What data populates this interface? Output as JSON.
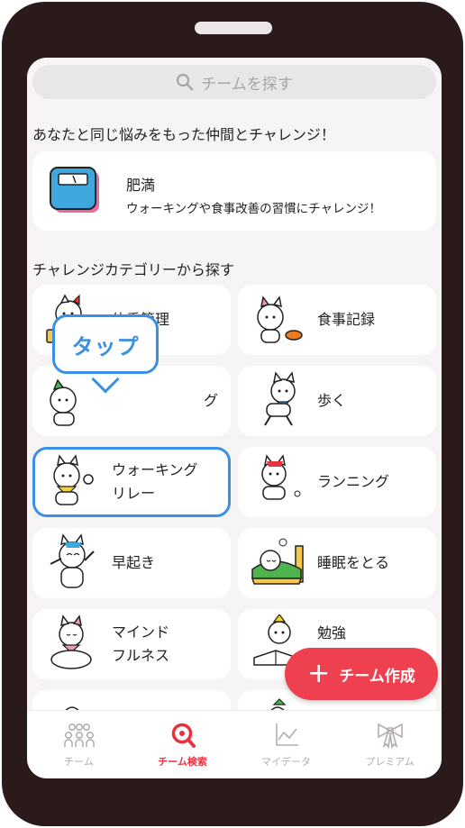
{
  "search": {
    "placeholder": "チームを探す"
  },
  "featured_section": {
    "title": "あなたと同じ悩みをもった仲間とチャレンジ！",
    "card": {
      "title": "肥満",
      "description": "ウォーキングや食事改善の習慣にチャレンジ！",
      "icon": "scale-icon"
    }
  },
  "category_section": {
    "title": "チャレンジカテゴリーから探す",
    "items": [
      {
        "label": "体重管理",
        "icon": "cat-scale-icon"
      },
      {
        "label": "食事記録",
        "icon": "cat-eating-icon"
      },
      {
        "label": "グ",
        "icon": "cat-exercise-icon"
      },
      {
        "label": "歩く",
        "icon": "cat-walking-icon"
      },
      {
        "label1": "ウォーキング",
        "label2": "リレー",
        "icon": "cat-relay-icon"
      },
      {
        "label": "ランニング",
        "icon": "cat-running-icon"
      },
      {
        "label": "早起き",
        "icon": "cat-wakeup-icon"
      },
      {
        "label": "睡眠をとる",
        "icon": "cat-sleep-icon"
      },
      {
        "label1": "マインド",
        "label2": "フルネス",
        "icon": "cat-meditation-icon"
      },
      {
        "label": "勉強",
        "icon": "cat-study-icon"
      }
    ]
  },
  "tooltip": {
    "text": "タップ"
  },
  "fab": {
    "label": "チーム作成"
  },
  "tabbar": {
    "items": [
      {
        "label": "チーム",
        "icon": "team-icon"
      },
      {
        "label": "チーム検索",
        "icon": "team-search-icon"
      },
      {
        "label": "マイデータ",
        "icon": "chart-icon"
      },
      {
        "label": "プレミアム",
        "icon": "ribbon-icon"
      }
    ]
  },
  "colors": {
    "accent": "#ef4050",
    "highlight": "#3b8fe4",
    "frame": "#2a1a1a",
    "background": "#f6f4f4"
  }
}
